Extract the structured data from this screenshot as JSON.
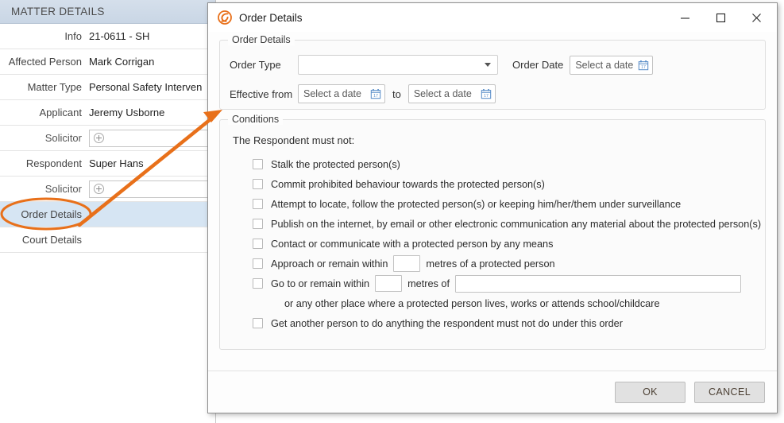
{
  "background_panel": {
    "header": "MATTER DETAILS",
    "rows": [
      {
        "label": "Info",
        "value": "21-0611 - SH",
        "type": "text",
        "indent": false,
        "selected": false
      },
      {
        "label": "Affected Person",
        "value": "Mark Corrigan",
        "type": "text",
        "indent": false,
        "selected": false
      },
      {
        "label": "Matter Type",
        "value": "Personal Safety Interven",
        "type": "text",
        "indent": false,
        "selected": false
      },
      {
        "label": "Applicant",
        "value": "Jeremy Usborne",
        "type": "text",
        "indent": false,
        "selected": false
      },
      {
        "label": "Solicitor",
        "value": "",
        "type": "picker",
        "indent": true,
        "selected": false
      },
      {
        "label": "Respondent",
        "value": "Super Hans",
        "type": "text",
        "indent": false,
        "selected": false
      },
      {
        "label": "Solicitor",
        "value": "",
        "type": "picker",
        "indent": true,
        "selected": false
      },
      {
        "label": "Order Details",
        "value": "",
        "type": "text",
        "indent": false,
        "selected": true
      },
      {
        "label": "Court Details",
        "value": "",
        "type": "text",
        "indent": false,
        "selected": false
      }
    ]
  },
  "dialog": {
    "title": "Order Details",
    "app_icon": "swirl-s-logo-icon",
    "window_controls": {
      "minimize": "minimize-icon",
      "maximize": "maximize-icon",
      "close": "close-icon"
    },
    "order_details": {
      "legend": "Order Details",
      "order_type_label": "Order Type",
      "order_type_value": "",
      "order_date_label": "Order Date",
      "order_date_placeholder": "Select a date",
      "effective_from_label": "Effective from",
      "effective_from_placeholder": "Select a date",
      "to_label": "to",
      "effective_to_placeholder": "Select a date"
    },
    "conditions": {
      "legend": "Conditions",
      "intro": "The Respondent must not:",
      "items": [
        {
          "id": "stalk",
          "text": "Stalk the protected person(s)",
          "checked": false
        },
        {
          "id": "prohibited-behaviour",
          "text": "Commit prohibited behaviour towards the protected person(s)",
          "checked": false
        },
        {
          "id": "locate-follow",
          "text": "Attempt to locate, follow the protected person(s) or keeping him/her/them under surveillance",
          "checked": false
        },
        {
          "id": "publish-internet",
          "text": "Publish on the internet, by email or other electronic communication any material about the protected person(s)",
          "checked": false
        },
        {
          "id": "contact-communicate",
          "text": "Contact or communicate with a protected person by any means",
          "checked": false
        },
        {
          "id": "approach-within",
          "text_before": "Approach or remain within",
          "distance_value": "",
          "text_after": "metres of a protected person",
          "checked": false
        },
        {
          "id": "go-to-within",
          "text_before": "Go to or remain within",
          "distance_value": "",
          "text_mid": "metres of",
          "place_value": "",
          "checked": false
        },
        {
          "id": "get-another-person",
          "text": "Get another person to do anything the respondent must not do under this order",
          "checked": false
        }
      ],
      "sub_note": "or any other place where a protected person lives, works or attends school/childcare"
    },
    "footer": {
      "ok_label": "OK",
      "cancel_label": "CANCEL"
    }
  },
  "annotation": {
    "highlight_target": "Order Details",
    "color": "#e8701a"
  }
}
